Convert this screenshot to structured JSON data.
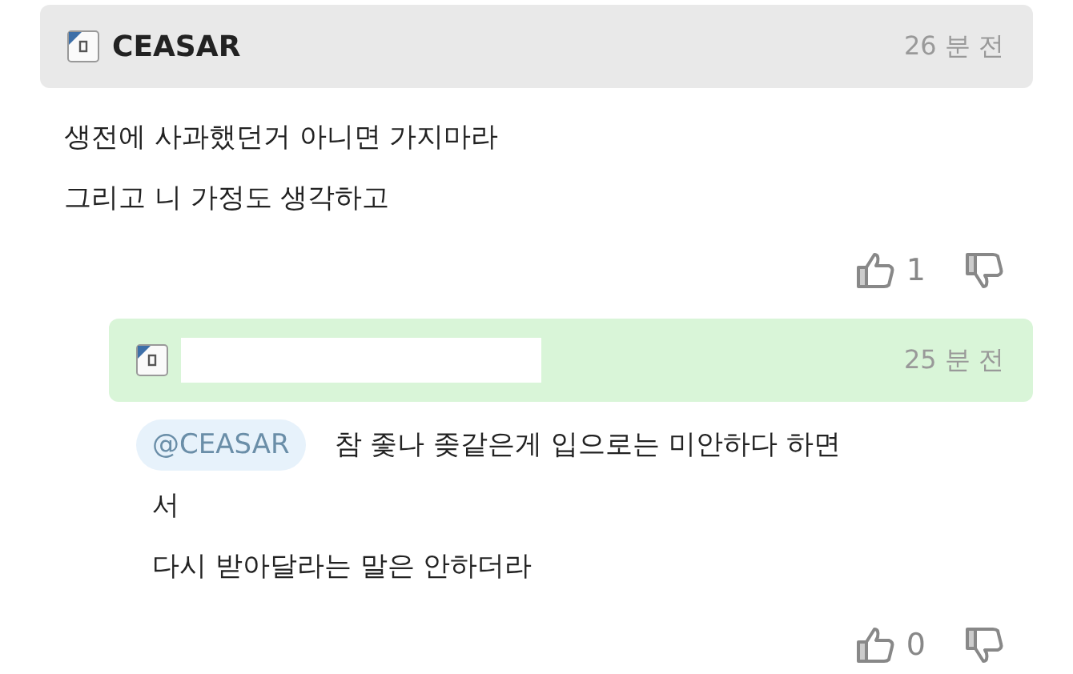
{
  "comments": [
    {
      "kind": "comment",
      "author": "CEASAR",
      "redacted": false,
      "time": "26 분 전",
      "lines": [
        "생전에 사과했던거 아니면 가지마라",
        "그리고 니 가정도 생각하고"
      ],
      "likes": "1"
    },
    {
      "kind": "reply",
      "redacted": true,
      "time": "25 분 전",
      "mention": "@CEASAR",
      "lines": [
        "참 좇나 좆같은게 입으로는 미안하다 하면",
        "서",
        "다시 받아달라는 말은 안하더라"
      ],
      "likes": "0"
    }
  ]
}
